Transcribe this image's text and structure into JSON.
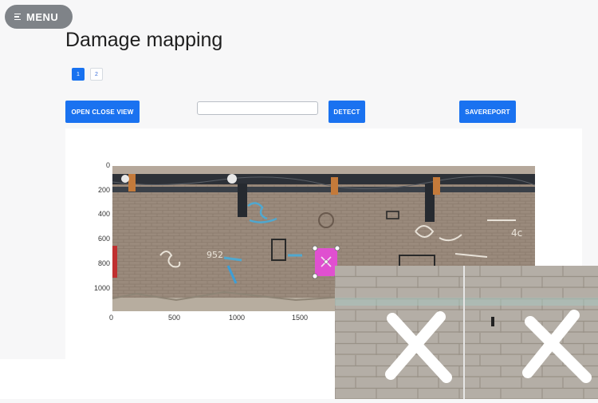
{
  "menu": {
    "label": "MENU",
    "icon": "hamburger-icon"
  },
  "page": {
    "title": "Damage mapping"
  },
  "pagination": {
    "pages": [
      "1",
      "2"
    ],
    "active": "1"
  },
  "toolbar": {
    "open_close_view": "OPEN CLOSE VIEW",
    "search_value": "",
    "detect": "DETECT",
    "save_report": "SAVEREPORT"
  },
  "plot": {
    "y_ticks": [
      "0",
      "200",
      "400",
      "600",
      "800",
      "1000"
    ],
    "x_ticks": [
      "0",
      "500",
      "1000",
      "1500"
    ]
  },
  "colors": {
    "accent": "#1a72f0",
    "menu_bg": "#7f8388",
    "selection": "#e050d0"
  }
}
